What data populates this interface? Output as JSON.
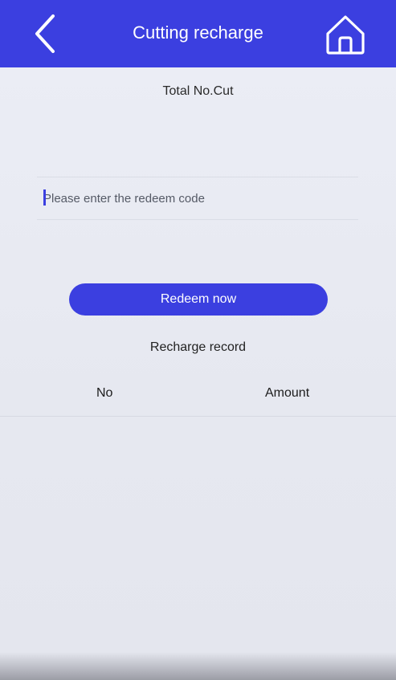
{
  "header": {
    "title": "Cutting recharge",
    "back_icon": "chevron-left-icon",
    "home_icon": "home-icon"
  },
  "summary": {
    "total_label": "Total No.Cut"
  },
  "redeem": {
    "placeholder": "Please enter the redeem code",
    "value": "",
    "button_label": "Redeem now"
  },
  "records": {
    "title": "Recharge record",
    "columns": [
      "No",
      "Amount"
    ],
    "rows": []
  },
  "colors": {
    "accent": "#3b3fe0",
    "background": "#e9ebf2",
    "text": "#222222"
  }
}
